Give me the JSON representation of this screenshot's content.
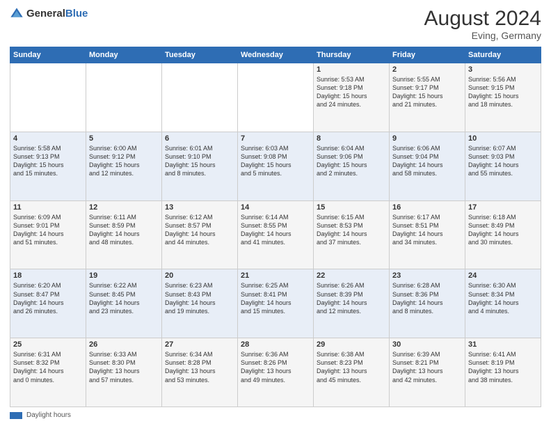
{
  "header": {
    "logo_general": "General",
    "logo_blue": "Blue",
    "title": "August 2024",
    "location": "Eving, Germany"
  },
  "days_of_week": [
    "Sunday",
    "Monday",
    "Tuesday",
    "Wednesday",
    "Thursday",
    "Friday",
    "Saturday"
  ],
  "weeks": [
    [
      {
        "day": "",
        "info": ""
      },
      {
        "day": "",
        "info": ""
      },
      {
        "day": "",
        "info": ""
      },
      {
        "day": "",
        "info": ""
      },
      {
        "day": "1",
        "info": "Sunrise: 5:53 AM\nSunset: 9:18 PM\nDaylight: 15 hours\nand 24 minutes."
      },
      {
        "day": "2",
        "info": "Sunrise: 5:55 AM\nSunset: 9:17 PM\nDaylight: 15 hours\nand 21 minutes."
      },
      {
        "day": "3",
        "info": "Sunrise: 5:56 AM\nSunset: 9:15 PM\nDaylight: 15 hours\nand 18 minutes."
      }
    ],
    [
      {
        "day": "4",
        "info": "Sunrise: 5:58 AM\nSunset: 9:13 PM\nDaylight: 15 hours\nand 15 minutes."
      },
      {
        "day": "5",
        "info": "Sunrise: 6:00 AM\nSunset: 9:12 PM\nDaylight: 15 hours\nand 12 minutes."
      },
      {
        "day": "6",
        "info": "Sunrise: 6:01 AM\nSunset: 9:10 PM\nDaylight: 15 hours\nand 8 minutes."
      },
      {
        "day": "7",
        "info": "Sunrise: 6:03 AM\nSunset: 9:08 PM\nDaylight: 15 hours\nand 5 minutes."
      },
      {
        "day": "8",
        "info": "Sunrise: 6:04 AM\nSunset: 9:06 PM\nDaylight: 15 hours\nand 2 minutes."
      },
      {
        "day": "9",
        "info": "Sunrise: 6:06 AM\nSunset: 9:04 PM\nDaylight: 14 hours\nand 58 minutes."
      },
      {
        "day": "10",
        "info": "Sunrise: 6:07 AM\nSunset: 9:03 PM\nDaylight: 14 hours\nand 55 minutes."
      }
    ],
    [
      {
        "day": "11",
        "info": "Sunrise: 6:09 AM\nSunset: 9:01 PM\nDaylight: 14 hours\nand 51 minutes."
      },
      {
        "day": "12",
        "info": "Sunrise: 6:11 AM\nSunset: 8:59 PM\nDaylight: 14 hours\nand 48 minutes."
      },
      {
        "day": "13",
        "info": "Sunrise: 6:12 AM\nSunset: 8:57 PM\nDaylight: 14 hours\nand 44 minutes."
      },
      {
        "day": "14",
        "info": "Sunrise: 6:14 AM\nSunset: 8:55 PM\nDaylight: 14 hours\nand 41 minutes."
      },
      {
        "day": "15",
        "info": "Sunrise: 6:15 AM\nSunset: 8:53 PM\nDaylight: 14 hours\nand 37 minutes."
      },
      {
        "day": "16",
        "info": "Sunrise: 6:17 AM\nSunset: 8:51 PM\nDaylight: 14 hours\nand 34 minutes."
      },
      {
        "day": "17",
        "info": "Sunrise: 6:18 AM\nSunset: 8:49 PM\nDaylight: 14 hours\nand 30 minutes."
      }
    ],
    [
      {
        "day": "18",
        "info": "Sunrise: 6:20 AM\nSunset: 8:47 PM\nDaylight: 14 hours\nand 26 minutes."
      },
      {
        "day": "19",
        "info": "Sunrise: 6:22 AM\nSunset: 8:45 PM\nDaylight: 14 hours\nand 23 minutes."
      },
      {
        "day": "20",
        "info": "Sunrise: 6:23 AM\nSunset: 8:43 PM\nDaylight: 14 hours\nand 19 minutes."
      },
      {
        "day": "21",
        "info": "Sunrise: 6:25 AM\nSunset: 8:41 PM\nDaylight: 14 hours\nand 15 minutes."
      },
      {
        "day": "22",
        "info": "Sunrise: 6:26 AM\nSunset: 8:39 PM\nDaylight: 14 hours\nand 12 minutes."
      },
      {
        "day": "23",
        "info": "Sunrise: 6:28 AM\nSunset: 8:36 PM\nDaylight: 14 hours\nand 8 minutes."
      },
      {
        "day": "24",
        "info": "Sunrise: 6:30 AM\nSunset: 8:34 PM\nDaylight: 14 hours\nand 4 minutes."
      }
    ],
    [
      {
        "day": "25",
        "info": "Sunrise: 6:31 AM\nSunset: 8:32 PM\nDaylight: 14 hours\nand 0 minutes."
      },
      {
        "day": "26",
        "info": "Sunrise: 6:33 AM\nSunset: 8:30 PM\nDaylight: 13 hours\nand 57 minutes."
      },
      {
        "day": "27",
        "info": "Sunrise: 6:34 AM\nSunset: 8:28 PM\nDaylight: 13 hours\nand 53 minutes."
      },
      {
        "day": "28",
        "info": "Sunrise: 6:36 AM\nSunset: 8:26 PM\nDaylight: 13 hours\nand 49 minutes."
      },
      {
        "day": "29",
        "info": "Sunrise: 6:38 AM\nSunset: 8:23 PM\nDaylight: 13 hours\nand 45 minutes."
      },
      {
        "day": "30",
        "info": "Sunrise: 6:39 AM\nSunset: 8:21 PM\nDaylight: 13 hours\nand 42 minutes."
      },
      {
        "day": "31",
        "info": "Sunrise: 6:41 AM\nSunset: 8:19 PM\nDaylight: 13 hours\nand 38 minutes."
      }
    ]
  ],
  "footer": {
    "bar_label": "Daylight hours"
  }
}
